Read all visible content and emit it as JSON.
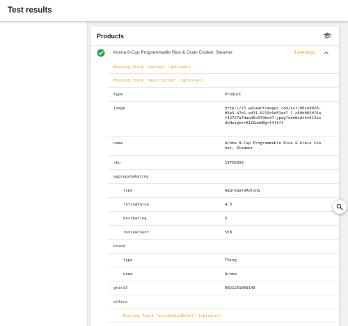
{
  "header": {
    "title": "Test results"
  },
  "card": {
    "title": "Products",
    "item": {
      "name": "Aroma 8-Cup Programmable Rice & Grain Cooker, Steamer",
      "warnings": "3 warnings"
    }
  },
  "rows": [
    {
      "kind": "warn",
      "text": "Missing field \"review\" (optional)"
    },
    {
      "kind": "warn",
      "text": "Missing field \"description\" (optional)"
    },
    {
      "kind": "kv",
      "key": "type",
      "value": "Product"
    },
    {
      "kind": "kv",
      "key": "image",
      "value": "http://i5.walmartimages.com/asr/00ce9020-06e5-47b1-ad31-0219c9d53ad7_1.c60b065076af42727a7daa46c079bcd7.jpeg?odnWidth=612&odnHeight=612&odnBg=ffffff"
    },
    {
      "kind": "kv",
      "key": "name",
      "value": "Aroma 8-Cup Programmable Rice & Grain Cooker, Steamer"
    },
    {
      "kind": "kv",
      "key": "sku",
      "value": "19756393"
    },
    {
      "kind": "kv",
      "key": "aggregateRating",
      "value": ""
    },
    {
      "kind": "kv",
      "nested": true,
      "key": "type",
      "value": "AggregateRating"
    },
    {
      "kind": "kv",
      "nested": true,
      "key": "ratingValue",
      "value": "4.3"
    },
    {
      "kind": "kv",
      "nested": true,
      "key": "bestRating",
      "value": "5"
    },
    {
      "kind": "kv",
      "nested": true,
      "key": "reviewCount",
      "value": "558"
    },
    {
      "kind": "kv",
      "key": "brand",
      "value": ""
    },
    {
      "kind": "kv",
      "nested": true,
      "key": "type",
      "value": "Thing"
    },
    {
      "kind": "kv",
      "nested": true,
      "key": "name",
      "value": "Aroma"
    },
    {
      "kind": "kv",
      "key": "gtin13",
      "value": "0021241009140"
    },
    {
      "kind": "kv",
      "key": "offers",
      "value": ""
    },
    {
      "kind": "warn",
      "nested": true,
      "text": "Missing field \"priceValidUntil\" (optional)"
    }
  ],
  "icons": {
    "learn": "graduation-cap-icon",
    "status": "check-circle-icon",
    "expand": "chevron-up-icon",
    "search": "search-icon"
  },
  "colors": {
    "success": "#2e9e4f",
    "warning": "#e6a000"
  }
}
